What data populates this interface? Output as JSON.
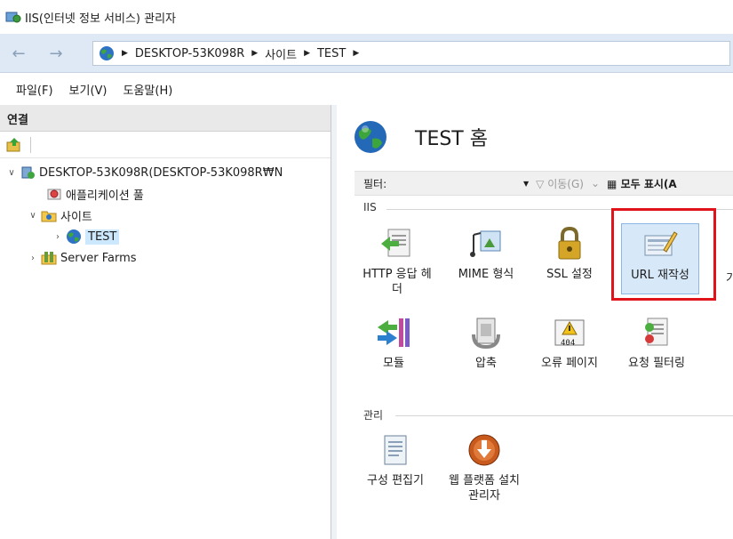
{
  "window": {
    "title": "IIS(인터넷 정보 서비스) 관리자"
  },
  "address": {
    "crumbs": [
      "DESKTOP-53K098R",
      "사이트",
      "TEST"
    ]
  },
  "menu": {
    "items": [
      "파일(F)",
      "보기(V)",
      "도움말(H)"
    ]
  },
  "connections": {
    "header": "연결",
    "tree": [
      {
        "label": "DESKTOP-53K098R(DESKTOP-53K098R₩N",
        "icon": "server-icon"
      },
      {
        "label": "애플리케이션 풀",
        "icon": "app-pool-icon"
      },
      {
        "label": "사이트",
        "icon": "sites-folder-icon"
      },
      {
        "label": "TEST",
        "icon": "globe-icon",
        "selected": true
      },
      {
        "label": "Server Farms",
        "icon": "server-farms-icon"
      }
    ]
  },
  "main": {
    "title": "TEST 홈",
    "filter": {
      "label": "필터:",
      "go": "이동(G)",
      "show_all": "모두 표시(A"
    },
    "groups": [
      {
        "name": "IIS",
        "features": [
          {
            "label": "HTTP 응답 헤더",
            "icon": "http-headers-icon"
          },
          {
            "label": "MIME 형식",
            "icon": "mime-types-icon"
          },
          {
            "label": "SSL 설정",
            "icon": "ssl-lock-icon"
          },
          {
            "label": "URL 재작성",
            "icon": "url-rewrite-icon",
            "highlighted": true
          },
          {
            "label": "모듈",
            "icon": "modules-icon"
          },
          {
            "label": "압축",
            "icon": "compression-icon"
          },
          {
            "label": "오류 페이지",
            "icon": "error-pages-icon"
          },
          {
            "label": "요청 필터링",
            "icon": "request-filtering-icon"
          }
        ],
        "partial_label": "기"
      },
      {
        "name": "관리",
        "features": [
          {
            "label": "구성 편집기",
            "icon": "config-editor-icon"
          },
          {
            "label": "웹 플랫폼 설치 관리자",
            "icon": "web-platform-installer-icon"
          }
        ]
      }
    ]
  },
  "colors": {
    "highlight_box": "#e0131a",
    "selection": "#cce8ff",
    "address_bar_bg": "#dfe9f5"
  },
  "error_page_icon_text": "404"
}
